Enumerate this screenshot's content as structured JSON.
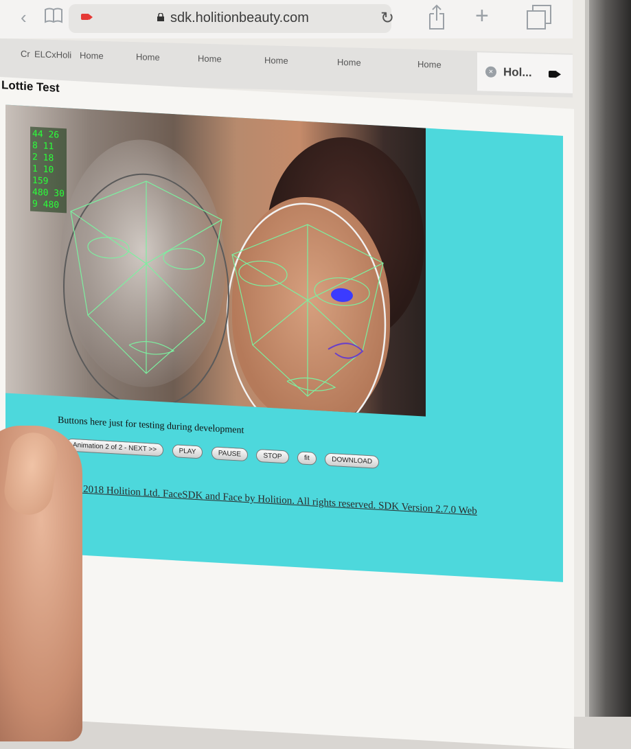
{
  "browser": {
    "url": "sdk.holitionbeauty.com",
    "tabs": [
      {
        "label": "Cr"
      },
      {
        "label": "ELCxHoli"
      },
      {
        "label": "Home"
      },
      {
        "label": "Home"
      },
      {
        "label": "Home"
      },
      {
        "label": "Home"
      },
      {
        "label": "Home"
      },
      {
        "label": "Home"
      }
    ],
    "active_tab": {
      "label": "Hol..."
    },
    "icons": [
      "back-icon",
      "bookmarks-icon",
      "camera-recording-icon",
      "lock-icon",
      "reload-icon",
      "share-icon",
      "new-tab-icon",
      "tabs-icon"
    ]
  },
  "page": {
    "title": "Lottie Test",
    "stats": [
      "44 26",
      "8 11",
      "2 18",
      "1 10",
      "159",
      "480 30",
      "9 480"
    ],
    "dev_note": "Buttons here just for testing during development",
    "buttons": {
      "next": "Animation 2 of 2 - NEXT >>",
      "play": "PLAY",
      "pause": "PAUSE",
      "stop": "STOP",
      "fit": "fit",
      "download": "DOWNLOAD"
    },
    "copyright": "© 2018 Holition Ltd. FaceSDK and Face by Holition. All rights reserved. SDK Version 2.7.0 Web"
  },
  "colors": {
    "stage_bg": "#4dd8dc",
    "mesh": "#7cf0a0",
    "stats_text": "#2bff3a"
  }
}
